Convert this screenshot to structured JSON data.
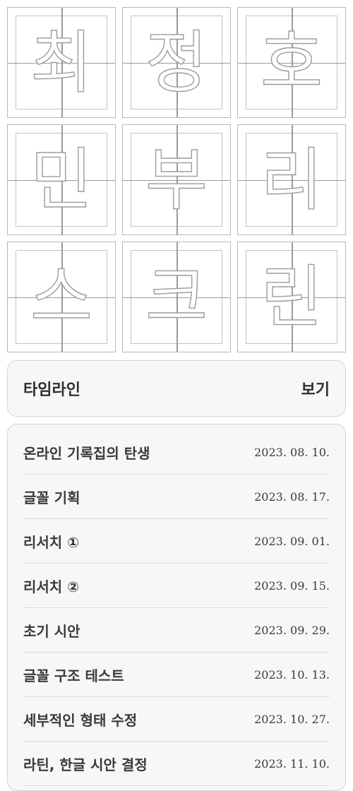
{
  "font_grid": [
    {
      "char": "최",
      "name": "glyph-choe"
    },
    {
      "char": "정",
      "name": "glyph-jeong"
    },
    {
      "char": "호",
      "name": "glyph-ho"
    },
    {
      "char": "민",
      "name": "glyph-min"
    },
    {
      "char": "부",
      "name": "glyph-bu"
    },
    {
      "char": "리",
      "name": "glyph-ri"
    },
    {
      "char": "스",
      "name": "glyph-seu"
    },
    {
      "char": "크",
      "name": "glyph-keu"
    },
    {
      "char": "린",
      "name": "glyph-rin"
    }
  ],
  "timeline": {
    "title": "타임라인",
    "view_label": "보기",
    "items": [
      {
        "label": "온라인 기록집의 탄생",
        "date": "2023. 08. 10."
      },
      {
        "label": "글꼴 기획",
        "date": "2023. 08. 17."
      },
      {
        "label": "리서치 ①",
        "date": "2023. 09. 01."
      },
      {
        "label": "리서치 ②",
        "date": "2023. 09. 15."
      },
      {
        "label": "초기 시안",
        "date": "2023. 09. 29."
      },
      {
        "label": "글꼴 구조 테스트",
        "date": "2023. 10. 13."
      },
      {
        "label": "세부적인 형태 수정",
        "date": "2023. 10. 27."
      },
      {
        "label": "라틴, 한글 시안 결정",
        "date": "2023. 11. 10."
      }
    ]
  },
  "colors": {
    "grid_line": "#9a9a9a",
    "panel_bg": "#f7f7f7",
    "panel_border": "#d4d4d4",
    "text": "#333333"
  }
}
